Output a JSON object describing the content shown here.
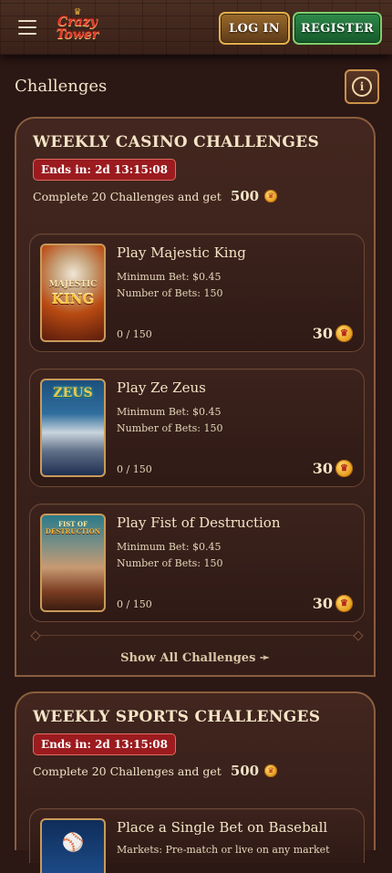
{
  "header": {
    "logo_line1": "Crazy",
    "logo_line2": "Tower",
    "login_label": "LOG IN",
    "register_label": "REGISTER"
  },
  "page": {
    "title": "Challenges"
  },
  "casino_section": {
    "title": "WEEKLY CASINO CHALLENGES",
    "ends_in": "Ends in: 2d 13:15:08",
    "reward_text": "Complete 20 Challenges and get",
    "reward_amount": "500",
    "show_all_label": "Show All Challenges ➛",
    "challenges": [
      {
        "title": "Play Majestic King",
        "min_bet": "Minimum Bet: $0.45",
        "num_bets": "Number of Bets: 150",
        "progress": "0 / 150",
        "reward": "30",
        "thumb_text1": "MAJESTIC",
        "thumb_text2": "KING"
      },
      {
        "title": "Play Ze Zeus",
        "min_bet": "Minimum Bet: $0.45",
        "num_bets": "Number of Bets: 150",
        "progress": "0 / 150",
        "reward": "30",
        "thumb_text1": "ZEUS"
      },
      {
        "title": "Play Fist of Destruction",
        "min_bet": "Minimum Bet: $0.45",
        "num_bets": "Number of Bets: 150",
        "progress": "0 / 150",
        "reward": "30",
        "thumb_text1": "FIST OF",
        "thumb_text2": "DESTRUCTION"
      }
    ]
  },
  "sports_section": {
    "title": "WEEKLY SPORTS CHALLENGES",
    "ends_in": "Ends in: 2d 13:15:08",
    "reward_text": "Complete 20 Challenges and get",
    "reward_amount": "500",
    "challenges": [
      {
        "title": "Place a Single Bet on Baseball",
        "markets": "Markets: Pre-match or live on any market"
      }
    ]
  },
  "icons": {
    "menu": "hamburger-menu-icon",
    "info": "info-icon",
    "coin": "crown-coin-icon"
  },
  "colors": {
    "background": "#2b1714",
    "panel_border": "#8a5e3e",
    "badge_red": "#9b1b1f",
    "register_green": "#2f8a4a",
    "login_gold": "#e2b04a",
    "coin_gold": "#e59a1c"
  }
}
